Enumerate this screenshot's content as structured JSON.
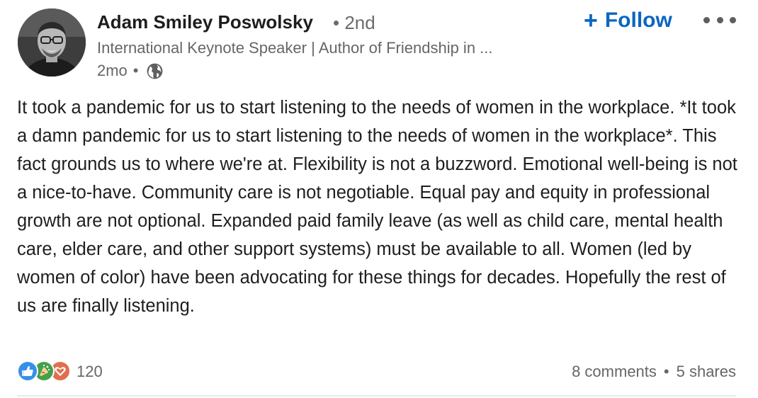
{
  "author": {
    "name": "Adam Smiley Poswolsky",
    "degree": "• 2nd",
    "headline": "International Keynote Speaker | Author of Friendship in ...",
    "posted_ago": "2mo",
    "separator": "•",
    "visibility_icon": "globe-icon"
  },
  "actions": {
    "follow_icon": "+",
    "follow_label": "Follow",
    "more_icon": "more-options-icon"
  },
  "post": {
    "text": "It took a pandemic for us to start listening to the needs of women in the workplace. *It took a damn pandemic for us to start listening to the needs of women in the workplace*. This fact grounds us to where we're at. Flexibility is not a buzzword. Emotional well-being is not a nice-to-have. Community care is not negotiable. Equal pay and equity in professional growth are not optional. Expanded paid family leave (as well as child care, mental health care, elder care, and other support systems) must be available to all. Women (led by women of color) have been advocating for these things for decades. Hopefully the rest of us are finally listening."
  },
  "social": {
    "reaction_icons": [
      "like-icon",
      "celebrate-icon",
      "love-icon"
    ],
    "reaction_count": "120",
    "comments": "8 comments",
    "separator": "•",
    "shares": "5 shares"
  },
  "colors": {
    "accent": "#0a66c2",
    "like": "#378fe9",
    "celebrate": "#44a04b",
    "love": "#df704d",
    "secondary_text": "#666666"
  }
}
